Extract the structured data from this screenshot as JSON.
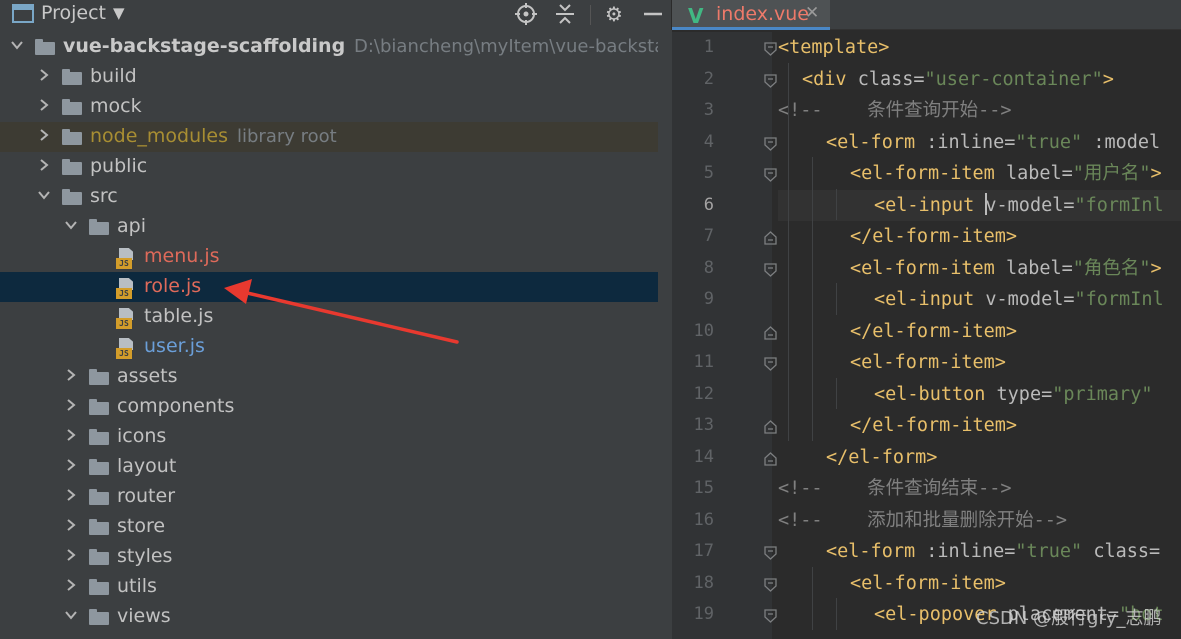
{
  "project_panel": {
    "title": "Project",
    "tree": [
      {
        "label": "vue-backstage-scaffolding",
        "path": "D:\\biancheng\\myItem\\vue-backstage-scaffolding",
        "type": "folder",
        "depth": 0,
        "expanded": true,
        "style": "root"
      },
      {
        "label": "build",
        "type": "folder",
        "depth": 1,
        "expanded": false
      },
      {
        "label": "mock",
        "type": "folder",
        "depth": 1,
        "expanded": false
      },
      {
        "label": "node_modules",
        "sub": "library root",
        "type": "folder",
        "depth": 1,
        "expanded": false,
        "style": "library"
      },
      {
        "label": "public",
        "type": "folder",
        "depth": 1,
        "expanded": false
      },
      {
        "label": "src",
        "type": "folder",
        "depth": 1,
        "expanded": true
      },
      {
        "label": "api",
        "type": "folder",
        "depth": 2,
        "expanded": true
      },
      {
        "label": "menu.js",
        "type": "js",
        "depth": 3,
        "style": "modified-red"
      },
      {
        "label": "role.js",
        "type": "js",
        "depth": 3,
        "style": "modified-red",
        "selected": true
      },
      {
        "label": "table.js",
        "type": "js",
        "depth": 3
      },
      {
        "label": "user.js",
        "type": "js",
        "depth": 3,
        "style": "modified-blue"
      },
      {
        "label": "assets",
        "type": "folder",
        "depth": 2,
        "expanded": false
      },
      {
        "label": "components",
        "type": "folder",
        "depth": 2,
        "expanded": false
      },
      {
        "label": "icons",
        "type": "folder",
        "depth": 2,
        "expanded": false
      },
      {
        "label": "layout",
        "type": "folder",
        "depth": 2,
        "expanded": false
      },
      {
        "label": "router",
        "type": "folder",
        "depth": 2,
        "expanded": false
      },
      {
        "label": "store",
        "type": "folder",
        "depth": 2,
        "expanded": false
      },
      {
        "label": "styles",
        "type": "folder",
        "depth": 2,
        "expanded": false
      },
      {
        "label": "utils",
        "type": "folder",
        "depth": 2,
        "expanded": false
      },
      {
        "label": "views",
        "type": "folder",
        "depth": 2,
        "expanded": true
      }
    ],
    "tools": [
      "locate-icon",
      "collapse-all-icon",
      "gear-icon",
      "minimize-icon"
    ]
  },
  "editor": {
    "tab": {
      "label": "index.vue",
      "icon": "vue-icon"
    },
    "current_line": 6,
    "lines": [
      {
        "n": 1,
        "indent": 0,
        "fold": "open",
        "tokens": [
          [
            "tag",
            "<template>"
          ]
        ]
      },
      {
        "n": 2,
        "indent": 1,
        "fold": "open",
        "tokens": [
          [
            "tag",
            "<div "
          ],
          [
            "attr",
            "class="
          ],
          [
            "str",
            "\"user-container\""
          ],
          [
            "tag",
            ">"
          ]
        ]
      },
      {
        "n": 3,
        "indent": 0,
        "fold": "",
        "tokens": [
          [
            "com",
            "<!--    条件查询开始-->"
          ]
        ]
      },
      {
        "n": 4,
        "indent": 2,
        "fold": "open",
        "tokens": [
          [
            "tag",
            "<el-form "
          ],
          [
            "attr",
            ":inline="
          ],
          [
            "str",
            "\"true\""
          ],
          [
            "attr",
            " :model"
          ]
        ]
      },
      {
        "n": 5,
        "indent": 3,
        "fold": "open",
        "tokens": [
          [
            "tag",
            "<el-form-item "
          ],
          [
            "attr",
            "label="
          ],
          [
            "str",
            "\"用户名\""
          ],
          [
            "tag",
            ">"
          ]
        ]
      },
      {
        "n": 6,
        "indent": 4,
        "fold": "",
        "tokens": [
          [
            "tag",
            "<el-input "
          ],
          [
            "caret",
            ""
          ],
          [
            "attr",
            "v-model="
          ],
          [
            "str",
            "\"formInl"
          ]
        ]
      },
      {
        "n": 7,
        "indent": 3,
        "fold": "close",
        "tokens": [
          [
            "tag",
            "</el-form-item>"
          ]
        ]
      },
      {
        "n": 8,
        "indent": 3,
        "fold": "open",
        "tokens": [
          [
            "tag",
            "<el-form-item "
          ],
          [
            "attr",
            "label="
          ],
          [
            "str",
            "\"角色名\""
          ],
          [
            "tag",
            ">"
          ]
        ]
      },
      {
        "n": 9,
        "indent": 4,
        "fold": "",
        "tokens": [
          [
            "tag",
            "<el-input "
          ],
          [
            "attr",
            "v-model="
          ],
          [
            "str",
            "\"formInl"
          ]
        ]
      },
      {
        "n": 10,
        "indent": 3,
        "fold": "close",
        "tokens": [
          [
            "tag",
            "</el-form-item>"
          ]
        ]
      },
      {
        "n": 11,
        "indent": 3,
        "fold": "open",
        "tokens": [
          [
            "tag",
            "<el-form-item>"
          ]
        ]
      },
      {
        "n": 12,
        "indent": 4,
        "fold": "",
        "tokens": [
          [
            "tag",
            "<el-button "
          ],
          [
            "attr",
            "type="
          ],
          [
            "str",
            "\"primary\""
          ]
        ]
      },
      {
        "n": 13,
        "indent": 3,
        "fold": "close",
        "tokens": [
          [
            "tag",
            "</el-form-item>"
          ]
        ]
      },
      {
        "n": 14,
        "indent": 2,
        "fold": "close",
        "tokens": [
          [
            "tag",
            "</el-form>"
          ]
        ]
      },
      {
        "n": 15,
        "indent": 0,
        "fold": "",
        "tokens": [
          [
            "com",
            "<!--    条件查询结束-->"
          ]
        ]
      },
      {
        "n": 16,
        "indent": 0,
        "fold": "",
        "tokens": [
          [
            "com",
            "<!--    添加和批量删除开始-->"
          ]
        ]
      },
      {
        "n": 17,
        "indent": 2,
        "fold": "open",
        "tokens": [
          [
            "tag",
            "<el-form "
          ],
          [
            "attr",
            ":inline="
          ],
          [
            "str",
            "\"true\""
          ],
          [
            "attr",
            " class="
          ]
        ]
      },
      {
        "n": 18,
        "indent": 3,
        "fold": "open",
        "tokens": [
          [
            "tag",
            "<el-form-item>"
          ]
        ]
      },
      {
        "n": 19,
        "indent": 4,
        "fold": "open",
        "tokens": [
          [
            "tag",
            "<el-popover "
          ],
          [
            "attr",
            "placement="
          ],
          [
            "str",
            "\"bot"
          ]
        ]
      }
    ]
  },
  "watermark": "CSDN @般行gry_志鹏",
  "colors": {
    "tag": "#e8bf6a",
    "string": "#6a8759",
    "comment": "#808080",
    "selection": "#0d293e",
    "arrow": "#e8392f"
  }
}
